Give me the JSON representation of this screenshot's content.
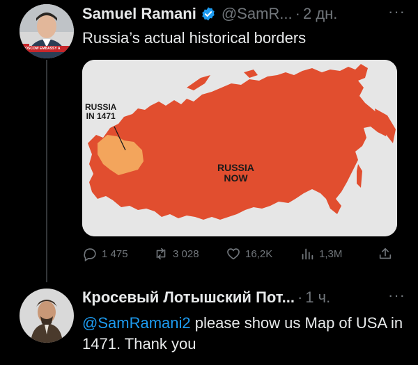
{
  "tweet": {
    "author_name": "Samuel Ramani",
    "handle": "@SamR...",
    "separator": "·",
    "time": "2 дн.",
    "more": "···",
    "text": "Russia’s actual historical borders",
    "map": {
      "label_1471": "RUSSIA\nIN 1471",
      "label_now": "RUSSIA\nNOW",
      "colors": {
        "russia_now": "#e14e2f",
        "russia_1471": "#f3a55c",
        "background": "#e6e6e6"
      }
    },
    "avatar_banner_text": "MOSCOW EMBASSY A",
    "actions": {
      "replies": "1 475",
      "reposts": "3 028",
      "likes": "16,2K",
      "views": "1,3M"
    }
  },
  "reply": {
    "author_name": "Кросевый Лотышский Пот...",
    "separator": "·",
    "time": "1 ч.",
    "more": "···",
    "mention": "@SamRamani2",
    "text": "please show us Map of USA in 1471. Thank you"
  },
  "colors": {
    "background": "#000000",
    "text": "#e7e9ea",
    "muted": "#71767b",
    "accent": "#1d9bf0"
  }
}
